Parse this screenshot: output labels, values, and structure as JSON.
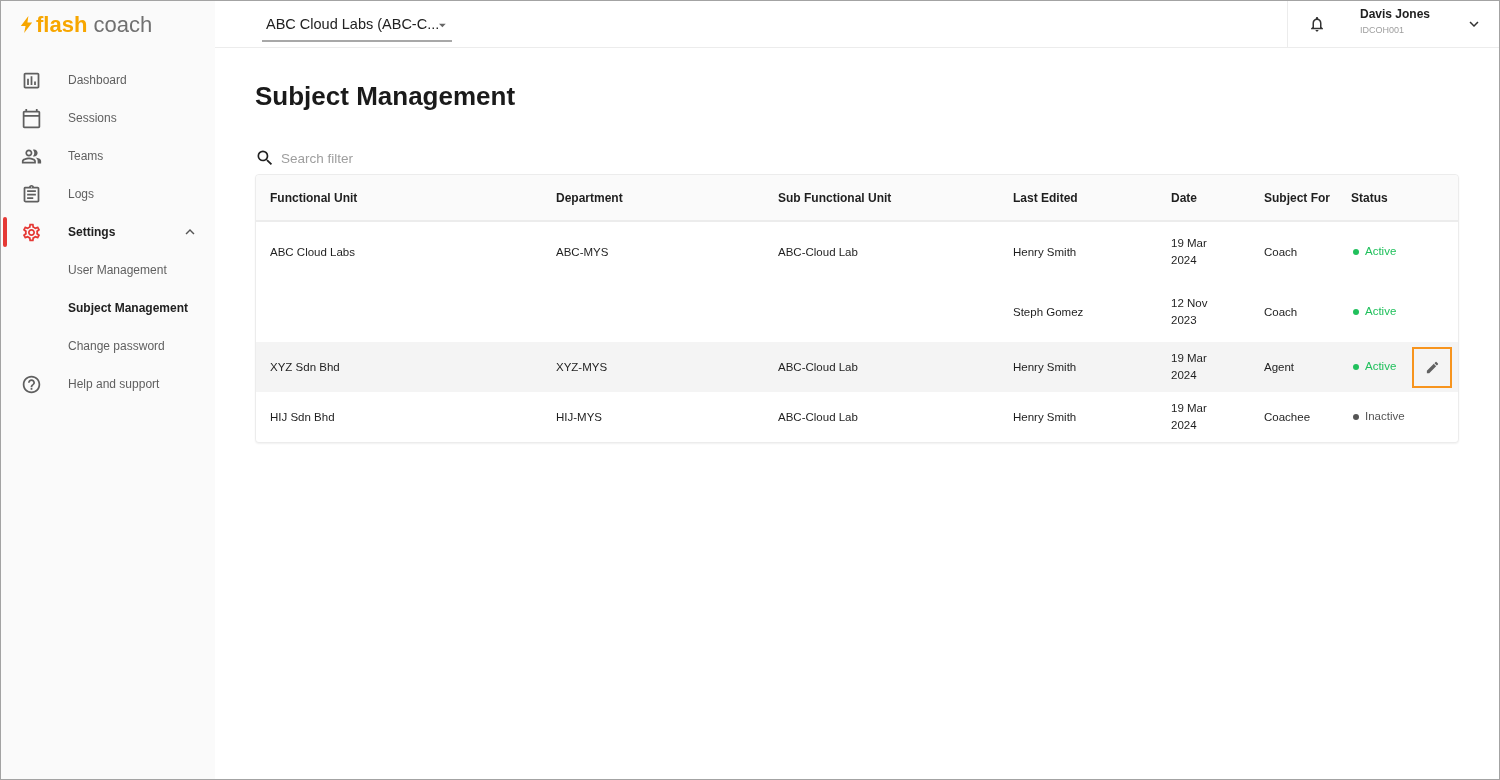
{
  "logo": {
    "part_1": "flash",
    "part_2": "coach"
  },
  "sidebar": {
    "items": [
      {
        "label": "Dashboard",
        "selected": false
      },
      {
        "label": "Sessions",
        "selected": false
      },
      {
        "label": "Teams",
        "selected": false
      },
      {
        "label": "Logs",
        "selected": false
      },
      {
        "label": "Settings",
        "selected": true,
        "expanded": true,
        "children": [
          {
            "label": "User Management",
            "selected": false
          },
          {
            "label": "Subject Management",
            "selected": true
          },
          {
            "label": "Change password",
            "selected": false
          }
        ]
      },
      {
        "label": "Help and support",
        "selected": false
      }
    ]
  },
  "top_bar": {
    "organization_select": {
      "value": "ABC Cloud Labs (ABC-C..."
    },
    "user": {
      "name": "Davis Jones",
      "id": "IDCOH001"
    }
  },
  "page_title": "Subject Management",
  "search": {
    "placeholder": "Search filter"
  },
  "table": {
    "columns": [
      "Functional Unit",
      "Department",
      "Sub Functional Unit",
      "Last Edited",
      "Date",
      "Subject For",
      "Status"
    ],
    "rows": [
      {
        "functional_unit": "ABC Cloud Labs",
        "department": "ABC-MYS",
        "sub_functional_unit": "ABC-Cloud Lab",
        "last_edited": "Henry Smith",
        "date": "19 Mar 2024",
        "subject_for": "Coach",
        "status": {
          "label": "Active",
          "color": "#20c05c"
        },
        "hovered": false
      },
      {
        "last_edited": "Steph Gomez",
        "date": "12 Nov 2023",
        "subject_for": "Coach",
        "status": {
          "label": "Active",
          "color": "#20c05c"
        },
        "hovered": false
      },
      {
        "functional_unit": "XYZ Sdn Bhd",
        "department": "XYZ-MYS",
        "sub_functional_unit": "ABC-Cloud Lab",
        "last_edited": "Henry Smith",
        "date": "19 Mar 2024",
        "subject_for": "Agent",
        "status": {
          "label": "Active",
          "color": "#20c05c"
        },
        "hovered": true
      },
      {
        "functional_unit": "HIJ Sdn Bhd",
        "department": "HIJ-MYS",
        "sub_functional_unit": "ABC-Cloud Lab",
        "last_edited": "Henry Smith",
        "date": "19 Mar 2024",
        "subject_for": "Coachee",
        "status": {
          "label": "Inactive",
          "color": "#555555"
        },
        "hovered": false
      }
    ]
  }
}
